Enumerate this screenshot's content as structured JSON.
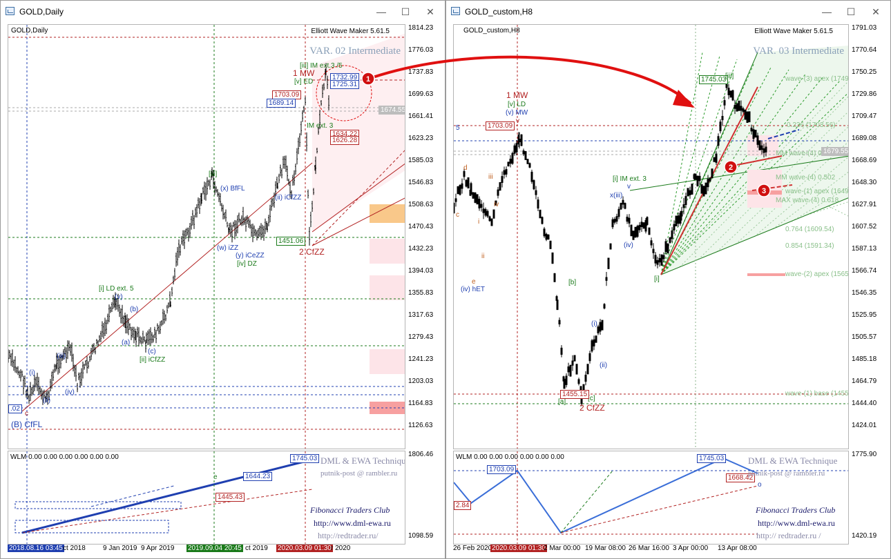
{
  "left": {
    "title": "GOLD,Daily",
    "symbol_label": "GOLD,Daily",
    "indicator": "Elliott Wave Maker 5.61.5",
    "variant": "VAR. 02 Intermediate",
    "y_ticks": [
      "1814.23",
      "1776.03",
      "1737.83",
      "1699.63",
      "1661.41",
      "1623.23",
      "1585.03",
      "1546.83",
      "1508.63",
      "1470.43",
      "1432.23",
      "1394.03",
      "1355.83",
      "1317.63",
      "1279.43",
      "1241.23",
      "1203.03",
      "1164.83",
      "1126.63"
    ],
    "sub_y_ticks": [
      "1806.46",
      "1098.59"
    ],
    "x_ticks": [
      "2018.08.16 03:45",
      "ct 2018",
      "9 Jan 2019",
      "9 Apr 2019",
      "2019.09.04 20:45",
      "ct 2019",
      "2020.03.09 01:30",
      "r 2020"
    ],
    "current_price": "1674.55",
    "labels": {
      "mw": "1 MW",
      "im_ext": "[iii] IM ext.3 /5",
      "v_ed": "[v] ED",
      "box_1703": "1703.09",
      "box_1689": "1689.14",
      "box_1732": "1732.99",
      "box_1725": "1725.31",
      "im_ext3": "IM ext. 3",
      "box_1634": "1634.22",
      "box_1626": "1626.28",
      "box_1451": "1451.06",
      "cfzz2": "2 CfZZ",
      "bfl": "(x) BfFL",
      "iii_g": "[iii]",
      "iz": "(w) iZZ",
      "icezz": "(y) iCeZZ",
      "ivdz": "[iv] DZ",
      "icfzz": "(ii) iCfZZ",
      "ld_ext": "[i] LD ext. 5",
      "iicfzz": "[ii] iCfZZ",
      "bcffl": "(B) CfFL",
      "c_lbl": "c",
      "price_02": ".02",
      "i_lbl": "(i)",
      "ii_lbl": "(ii)",
      "iii_lbl": "(iii)",
      "iv_lbl": "(iv)",
      "v_lbl": "(v)",
      "a_lbl": "(a)",
      "b_lbl": "(b)",
      "c2_lbl": "(c)"
    },
    "sub": {
      "wlm": "WLM 0.00 0.00 0.00 0.00 0.00 0.00",
      "box_1745": "1745.03",
      "box_1644": "1644.23",
      "box_1445": "1445.43",
      "e_lbl": "e"
    },
    "footer": {
      "technique": "DML & EWA Technique",
      "email": "putnik-post @ rambler.ru",
      "fib": "Fibonacci   Traders   Club",
      "url1": "http://www.dml-ewa.ru",
      "url2": "http://redtrader.ru/"
    },
    "marker": "1"
  },
  "right": {
    "title": "GOLD_custom,H8",
    "symbol_label": "GOLD_custom,H8",
    "indicator": "Elliott Wave Maker 5.61.5",
    "variant": "VAR. 03 Intermediate",
    "y_ticks": [
      "1791.03",
      "1770.64",
      "1750.25",
      "1729.86",
      "1709.47",
      "1689.08",
      "1668.69",
      "1648.30",
      "1627.91",
      "1607.52",
      "1587.13",
      "1566.74",
      "1546.35",
      "1525.95",
      "1505.57",
      "1485.18",
      "1464.79",
      "1444.40",
      "1424.01"
    ],
    "sub_y_ticks": [
      "1775.90",
      "1420.19"
    ],
    "x_ticks": [
      "26 Feb 2020",
      "2020.03.09 01:30",
      "2 Mar 00:00",
      "19 Mar 08:00",
      "26 Mar 16:00",
      "3 Apr 00:00",
      "13 Apr 08:00"
    ],
    "current_price": "1679.55",
    "labels": {
      "mw": "1 MW",
      "vld": "[v] LD",
      "vmw": "(v) MW",
      "box_1703": "1703.09",
      "v_small": "v",
      "iii_box": "[iii]",
      "box_1745": "1745.03",
      "im_ext3": "[i] IM ext. 3",
      "xiii": "x(iii)",
      "iv": "(iv)",
      "i_g": "[i]",
      "b_g": "[b]",
      "a_g": "[a]",
      "c_g": "[c]",
      "box_1455": "1455.15",
      "cfzz2": "2 CfZZ",
      "iv_het": "(iv) hET",
      "e": "e",
      "i_lbl": "(i)",
      "ii_lbl": "(ii)",
      "iii_r": "iii",
      "iv_r": "iv",
      "d_r": "d",
      "c_r": "c",
      "i_r": "i",
      "ii_r": "ii",
      "five": "5",
      "wave3": "wave-(3) apex (1749",
      "fib236": "0.236 (1703.56)",
      "wave4a": "MM wave-(4) 0.382",
      "wave4b": "MM wave-(4) 0.502",
      "wave1apex": "wave-(1) apex (1649",
      "wave4c": "MAX wave-(4) 0.618",
      "fib764": "0.764 (1609.54)",
      "fib854": "0.854 (1591.34)",
      "wave2apex": "wave-(2) apex (1565",
      "wave1base": "wave-(1) base (1455"
    },
    "sub": {
      "wlm": "WLM 0.00 0.00 0.00 0.00 0.00 0.00",
      "box_1703": "1703.09",
      "box_1745": "1745.03",
      "box_1668": "1668.42",
      "box_284": "2.84",
      "o_lbl": "o",
      "v_lbl": "v"
    },
    "footer": {
      "technique": "DML & EWA Technique",
      "email": "putnik-post @ rambler.ru",
      "fib": "Fibonacci   Traders   Club",
      "url1": "http://www.dml-ewa.ru",
      "url2": "http:// redtrader.ru /"
    },
    "markers": [
      "2",
      "3"
    ]
  },
  "window_buttons": {
    "minimize": "—",
    "maximize": "☐",
    "close": "✕"
  },
  "colors": {
    "bull": "#000000",
    "bear": "#000000",
    "blue": "#1f3fb0",
    "red": "#cc1111",
    "green": "#1a7a1a",
    "fan": "#e8f5e8",
    "pinkzone": "#fde4e8"
  }
}
